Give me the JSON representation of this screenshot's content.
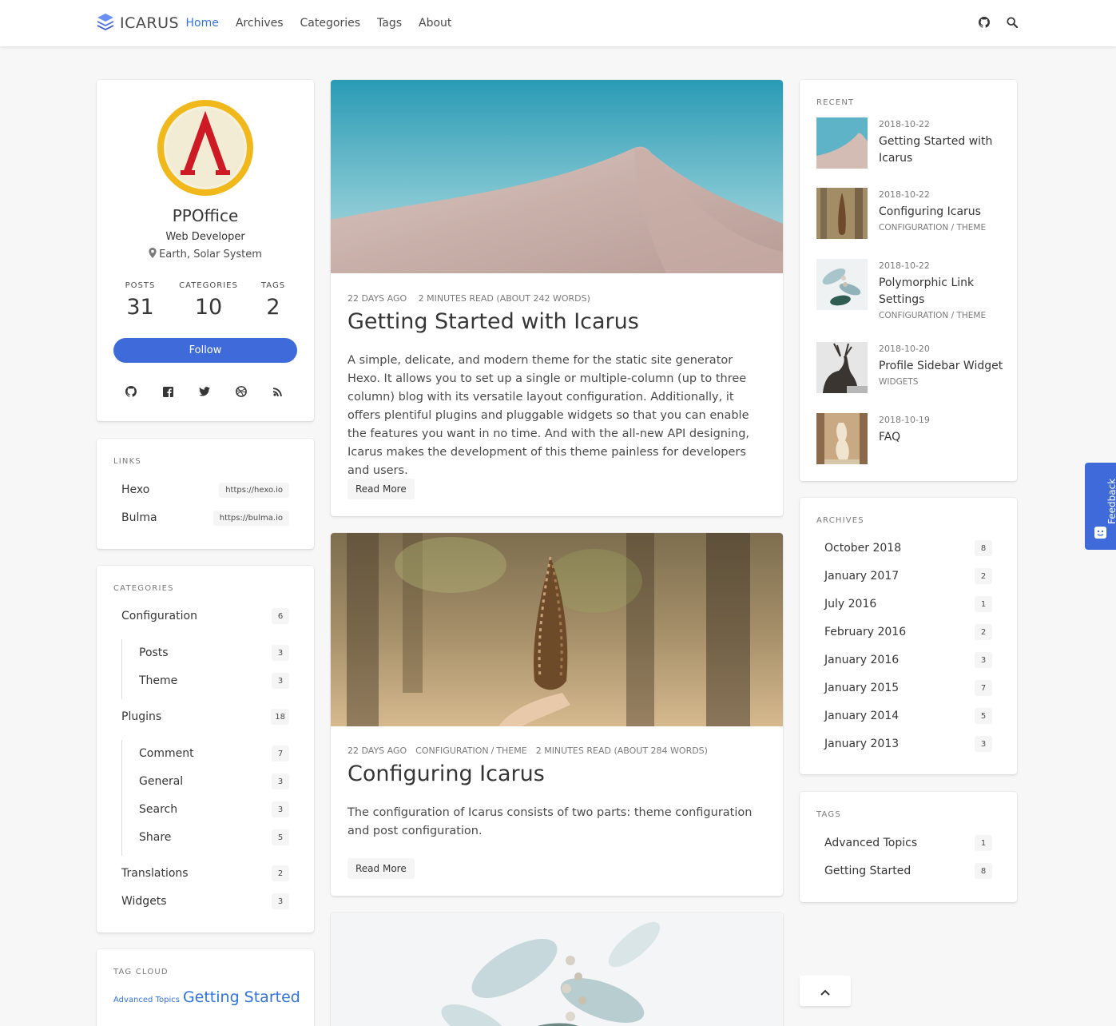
{
  "navbar": {
    "brand": "ICARUS",
    "links": [
      "Home",
      "Archives",
      "Categories",
      "Tags",
      "About"
    ],
    "active_link": "Home",
    "icons": [
      "github-icon",
      "search-icon"
    ]
  },
  "profile": {
    "name": "PPOffice",
    "role": "Web Developer",
    "location": "Earth, Solar System",
    "stats": [
      {
        "label": "POSTS",
        "value": "31"
      },
      {
        "label": "CATEGORIES",
        "value": "10"
      },
      {
        "label": "TAGS",
        "value": "2"
      }
    ],
    "follow_label": "Follow",
    "social_icons": [
      "github-icon",
      "facebook-icon",
      "twitter-icon",
      "dribbble-icon",
      "rss-icon"
    ],
    "accent": "#3e6bd9"
  },
  "links": {
    "label": "LINKS",
    "items": [
      {
        "name": "Hexo",
        "url": "https://hexo.io"
      },
      {
        "name": "Bulma",
        "url": "https://bulma.io"
      }
    ]
  },
  "categories": {
    "label": "CATEGORIES",
    "items": [
      {
        "name": "Configuration",
        "count": "6"
      },
      {
        "name": "Posts",
        "count": "3"
      },
      {
        "name": "Theme",
        "count": "3"
      },
      {
        "name": "Plugins",
        "count": "18"
      },
      {
        "name": "Comment",
        "count": "7"
      },
      {
        "name": "General",
        "count": "3"
      },
      {
        "name": "Search",
        "count": "3"
      },
      {
        "name": "Share",
        "count": "5"
      },
      {
        "name": "Translations",
        "count": "2"
      },
      {
        "name": "Widgets",
        "count": "3"
      }
    ]
  },
  "tag_cloud": {
    "label": "TAG CLOUD",
    "small": "Advanced Topics",
    "large": "Getting Started"
  },
  "posts": [
    {
      "meta_date": "22 DAYS AGO",
      "meta_read": "2 MINUTES READ (ABOUT 242 WORDS)",
      "title": "Getting Started with Icarus",
      "excerpt": "A simple, delicate, and modern theme for the static site generator Hexo. It allows you to set up a single or multiple-column (up to three column) blog with its versatile layout configuration. Additionally, it offers plentiful plugins and pluggable widgets so that you can enable the features you want in no time. And with the all-new API designing, Icarus makes the development of this theme painless for developers and users.",
      "read_more": "Read More"
    },
    {
      "meta_date": "22 DAYS AGO",
      "meta_cat1": "CONFIGURATION",
      "meta_sep": "/",
      "meta_cat2": "THEME",
      "meta_read": "2 MINUTES READ (ABOUT 284 WORDS)",
      "title": "Configuring Icarus",
      "excerpt": "The configuration of Icarus consists of two parts: theme configuration and post configuration.",
      "read_more": "Read More"
    }
  ],
  "recent": {
    "label": "RECENT",
    "items": [
      {
        "date": "2018-10-22",
        "title": "Getting Started with Icarus",
        "category": ""
      },
      {
        "date": "2018-10-22",
        "title": "Configuring Icarus",
        "category": "CONFIGURATION / THEME"
      },
      {
        "date": "2018-10-22",
        "title": "Polymorphic Link Settings",
        "category": "CONFIGURATION / THEME"
      },
      {
        "date": "2018-10-20",
        "title": "Profile Sidebar Widget",
        "category": "WIDGETS"
      },
      {
        "date": "2018-10-19",
        "title": "FAQ",
        "category": ""
      }
    ]
  },
  "archives": {
    "label": "ARCHIVES",
    "items": [
      {
        "name": "October 2018",
        "count": "8"
      },
      {
        "name": "January 2017",
        "count": "2"
      },
      {
        "name": "July 2016",
        "count": "1"
      },
      {
        "name": "February 2016",
        "count": "2"
      },
      {
        "name": "January 2016",
        "count": "3"
      },
      {
        "name": "January 2015",
        "count": "7"
      },
      {
        "name": "January 2014",
        "count": "5"
      },
      {
        "name": "January 2013",
        "count": "3"
      }
    ]
  },
  "tags": {
    "label": "TAGS",
    "items": [
      {
        "name": "Advanced Topics",
        "count": "1"
      },
      {
        "name": "Getting Started",
        "count": "8"
      }
    ]
  },
  "feedback_label": "Feedback"
}
